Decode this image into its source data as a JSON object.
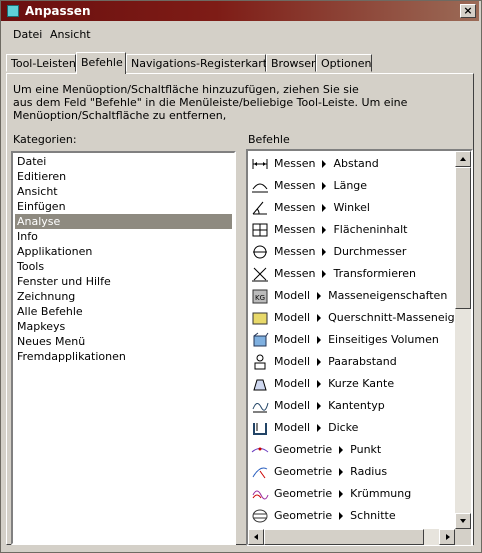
{
  "window": {
    "title": "Anpassen",
    "close_label": "×"
  },
  "menu": [
    "Datei",
    "Ansicht"
  ],
  "tabs": [
    "Tool-Leisten",
    "Befehle",
    "Navigations-Registerkarten",
    "Browser",
    "Optionen"
  ],
  "active_tab": "Befehle",
  "description": [
    "Um eine Menüoption/Schaltfläche hinzuzufügen, ziehen Sie sie",
    "aus dem Feld \"Befehle\" in die Menüleiste/beliebige Tool-Leiste. Um eine",
    "Menüoption/Schaltfläche zu entfernen,"
  ],
  "categories_label": "Kategorien:",
  "commands_label": "Befehle",
  "categories": [
    "Datei",
    "Editieren",
    "Ansicht",
    "Einfügen",
    "Analyse",
    "Info",
    "Applikationen",
    "Tools",
    "Fenster und Hilfe",
    "Zeichnung",
    "Alle Befehle",
    "Mapkeys",
    "Neues Menü",
    "Fremdapplikationen"
  ],
  "selected_category": "Analyse",
  "commands": [
    {
      "group": "Messen",
      "name": "Abstand",
      "icon": "measure-distance-icon"
    },
    {
      "group": "Messen",
      "name": "Länge",
      "icon": "measure-length-icon"
    },
    {
      "group": "Messen",
      "name": "Winkel",
      "icon": "measure-angle-icon"
    },
    {
      "group": "Messen",
      "name": "Flächeninhalt",
      "icon": "measure-area-icon"
    },
    {
      "group": "Messen",
      "name": "Durchmesser",
      "icon": "measure-diameter-icon"
    },
    {
      "group": "Messen",
      "name": "Transformieren",
      "icon": "measure-transform-icon"
    },
    {
      "group": "Modell",
      "name": "Masseneigenschaften",
      "icon": "mass-properties-icon"
    },
    {
      "group": "Modell",
      "name": "Querschnitt-Masseneigensch",
      "icon": "cross-section-mass-icon"
    },
    {
      "group": "Modell",
      "name": "Einseitiges Volumen",
      "icon": "one-sided-volume-icon"
    },
    {
      "group": "Modell",
      "name": "Paarabstand",
      "icon": "pairs-clearance-icon"
    },
    {
      "group": "Modell",
      "name": "Kurze Kante",
      "icon": "short-edge-icon"
    },
    {
      "group": "Modell",
      "name": "Kantentyp",
      "icon": "edge-type-icon"
    },
    {
      "group": "Modell",
      "name": "Dicke",
      "icon": "thickness-icon"
    },
    {
      "group": "Geometrie",
      "name": "Punkt",
      "icon": "geometry-point-icon"
    },
    {
      "group": "Geometrie",
      "name": "Radius",
      "icon": "geometry-radius-icon"
    },
    {
      "group": "Geometrie",
      "name": "Krümmung",
      "icon": "geometry-curvature-icon"
    },
    {
      "group": "Geometrie",
      "name": "Schnitte",
      "icon": "geometry-sections-icon"
    }
  ]
}
